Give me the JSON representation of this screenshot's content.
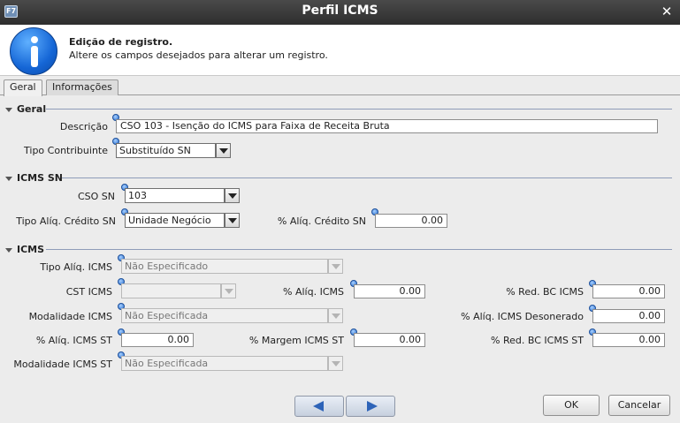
{
  "window": {
    "title": "Perfil ICMS",
    "app_icon": "F7"
  },
  "header": {
    "title": "Edição de registro.",
    "subtitle": "Altere os campos desejados para alterar um registro."
  },
  "tabs": [
    "Geral",
    "Informações"
  ],
  "geral": {
    "title": "Geral",
    "descricao_label": "Descrição",
    "descricao_value": "CSO 103 - Isenção do ICMS para Faixa de Receita Bruta",
    "tipo_contribuinte_label": "Tipo Contribuinte",
    "tipo_contribuinte_value": "Substituído SN"
  },
  "icms_sn": {
    "title": "ICMS SN",
    "cso_label": "CSO SN",
    "cso_value": "103",
    "tipo_aliq_label": "Tipo Alíq. Crédito SN",
    "tipo_aliq_value": "Unidade Negócio",
    "aliq_credito_label": "% Alíq. Crédito SN",
    "aliq_credito_value": "0.00"
  },
  "icms": {
    "title": "ICMS",
    "tipo_aliq_label": "Tipo Alíq. ICMS",
    "tipo_aliq_value": "Não Especificado",
    "cst_label": "CST ICMS",
    "cst_value": "",
    "aliq_label": "% Alíq. ICMS",
    "aliq_value": "0.00",
    "red_bc_label": "% Red. BC ICMS",
    "red_bc_value": "0.00",
    "modalidade_label": "Modalidade ICMS",
    "modalidade_value": "Não Especificada",
    "aliq_desonerado_label": "% Alíq. ICMS Desonerado",
    "aliq_desonerado_value": "0.00",
    "aliq_st_label": "% Alíq. ICMS ST",
    "aliq_st_value": "0.00",
    "margem_st_label": "% Margem ICMS ST",
    "margem_st_value": "0.00",
    "red_bc_st_label": "% Red. BC ICMS ST",
    "red_bc_st_value": "0.00",
    "modalidade_st_label": "Modalidade ICMS ST",
    "modalidade_st_value": "Não Especificada"
  },
  "buttons": {
    "ok": "OK",
    "cancel": "Cancelar"
  }
}
